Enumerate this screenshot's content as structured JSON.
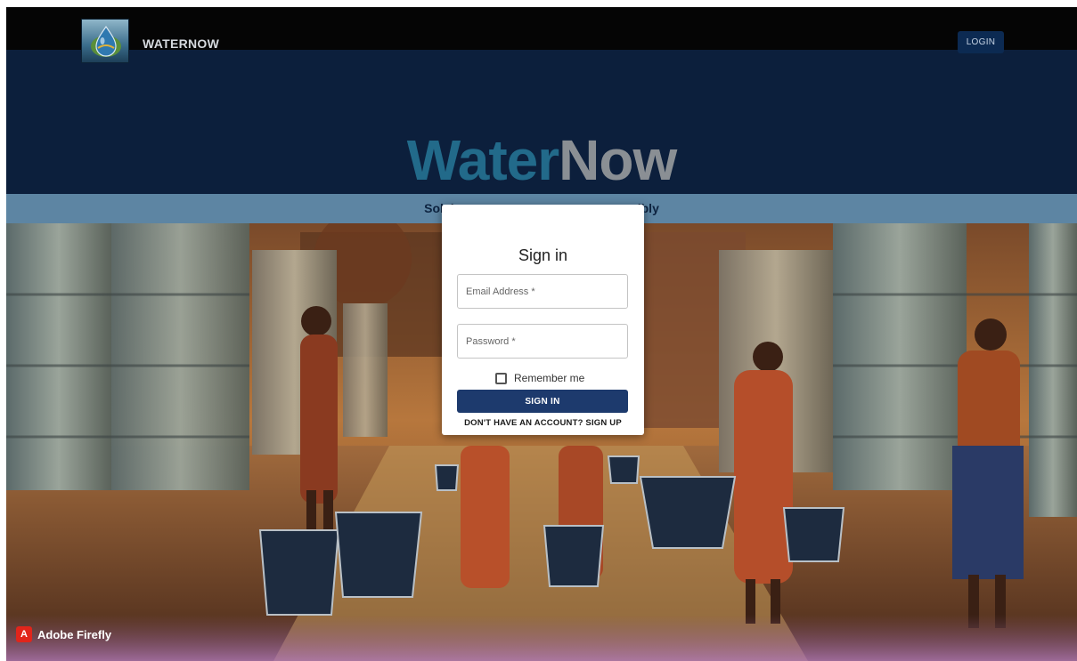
{
  "navbar": {
    "brand": "WATERNOW",
    "login_label": "LOGIN",
    "logo_icon": "water-drop-logo-icon"
  },
  "hero": {
    "title_part1": "Water",
    "title_part2": "Now",
    "tagline": "Solvi                                                   sibly"
  },
  "signin": {
    "title": "Sign in",
    "email_placeholder": "Email Address *",
    "email_value": "",
    "password_placeholder": "Password *",
    "password_value": "",
    "remember_label": "Remember me",
    "remember_checked": false,
    "submit_label": "SIGN IN",
    "signup_link": "DON'T HAVE AN ACCOUNT? SIGN UP"
  },
  "badge": {
    "text": "Adobe Firefly",
    "icon": "adobe-icon"
  },
  "colors": {
    "navbar_bg": "#050505",
    "hero_bg": "#0c1f3c",
    "title_water": "#226a8a",
    "title_now": "#8a8f94",
    "tagline_strip": "#5d85a3",
    "primary_button": "#1d3a6d"
  }
}
